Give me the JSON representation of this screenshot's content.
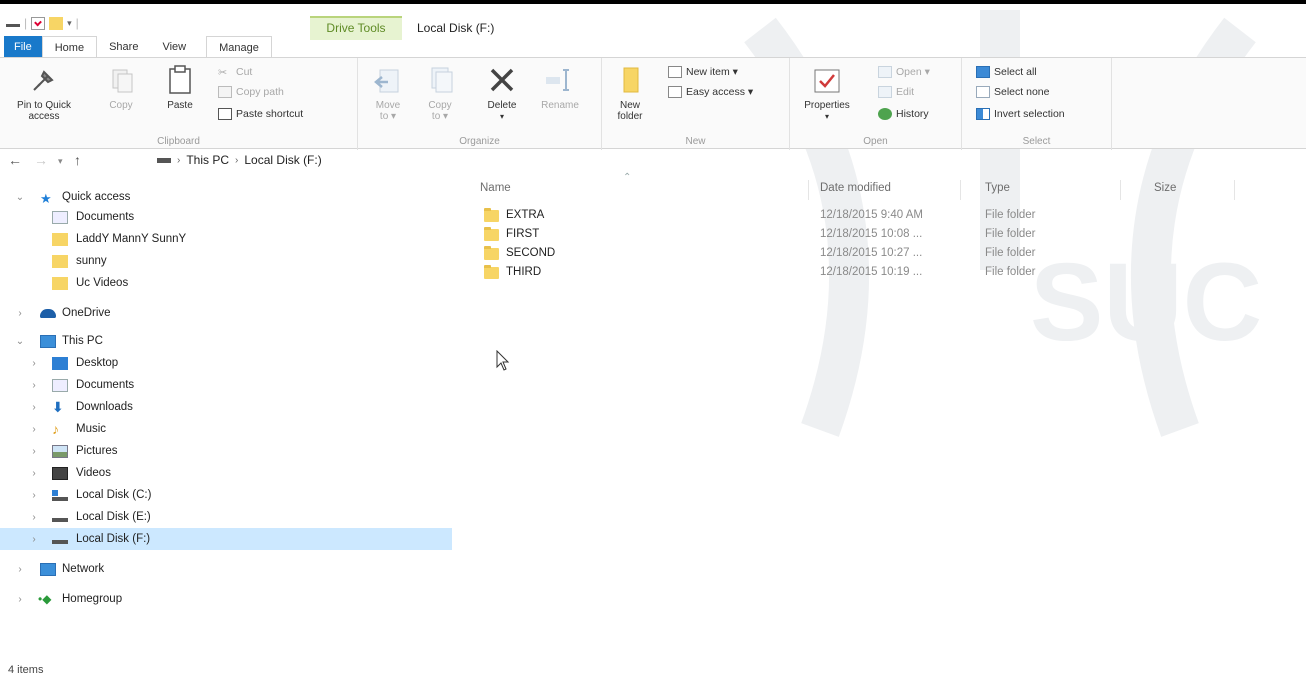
{
  "window": {
    "context_tab": "Drive Tools",
    "title": "Local Disk (F:)"
  },
  "tabs": [
    {
      "label": "File"
    },
    {
      "label": "Home"
    },
    {
      "label": "Share"
    },
    {
      "label": "View"
    },
    {
      "label": "Manage"
    }
  ],
  "ribbon": {
    "clipboard": {
      "label": "Clipboard",
      "pin_label_1": "Pin to Quick",
      "pin_label_2": "access",
      "copy": "Copy",
      "paste": "Paste",
      "cut": "Cut",
      "copy_path": "Copy path",
      "paste_shortcut": "Paste shortcut"
    },
    "organize": {
      "label": "Organize",
      "move_to_1": "Move",
      "move_to_2": "to ▾",
      "copy_to_1": "Copy",
      "copy_to_2": "to ▾",
      "delete": "Delete",
      "rename": "Rename"
    },
    "new": {
      "label": "New",
      "new_folder_1": "New",
      "new_folder_2": "folder",
      "new_item": "New item ▾",
      "easy_access": "Easy access ▾"
    },
    "open": {
      "label": "Open",
      "properties": "Properties",
      "open": "Open ▾",
      "edit": "Edit",
      "history": "History"
    },
    "select": {
      "label": "Select",
      "select_all": "Select all",
      "select_none": "Select none",
      "invert_selection": "Invert selection"
    }
  },
  "address": {
    "crumbs": [
      "This PC",
      "Local Disk (F:)"
    ]
  },
  "navpane": {
    "quick_access": "Quick access",
    "qa_items": [
      "Documents",
      "LaddY MannY SunnY",
      "sunny",
      "Uc Videos"
    ],
    "onedrive": "OneDrive",
    "this_pc": "This PC",
    "pc_items": [
      "Desktop",
      "Documents",
      "Downloads",
      "Music",
      "Pictures",
      "Videos",
      "Local Disk (C:)",
      "Local Disk (E:)",
      "Local Disk (F:)"
    ],
    "network": "Network",
    "homegroup": "Homegroup"
  },
  "columns": {
    "name": "Name",
    "date": "Date modified",
    "type": "Type",
    "size": "Size"
  },
  "files": [
    {
      "name": "EXTRA",
      "date": "12/18/2015 9:40 AM",
      "type": "File folder"
    },
    {
      "name": "FIRST",
      "date": "12/18/2015 10:08 ...",
      "type": "File folder"
    },
    {
      "name": "SECOND",
      "date": "12/18/2015 10:27 ...",
      "type": "File folder"
    },
    {
      "name": "THIRD",
      "date": "12/18/2015 10:19 ...",
      "type": "File folder"
    }
  ],
  "status": {
    "items": "4 items"
  },
  "colors": {
    "file_tab": "#1979ca",
    "selection": "#cce8ff",
    "folder": "#f7d565"
  }
}
